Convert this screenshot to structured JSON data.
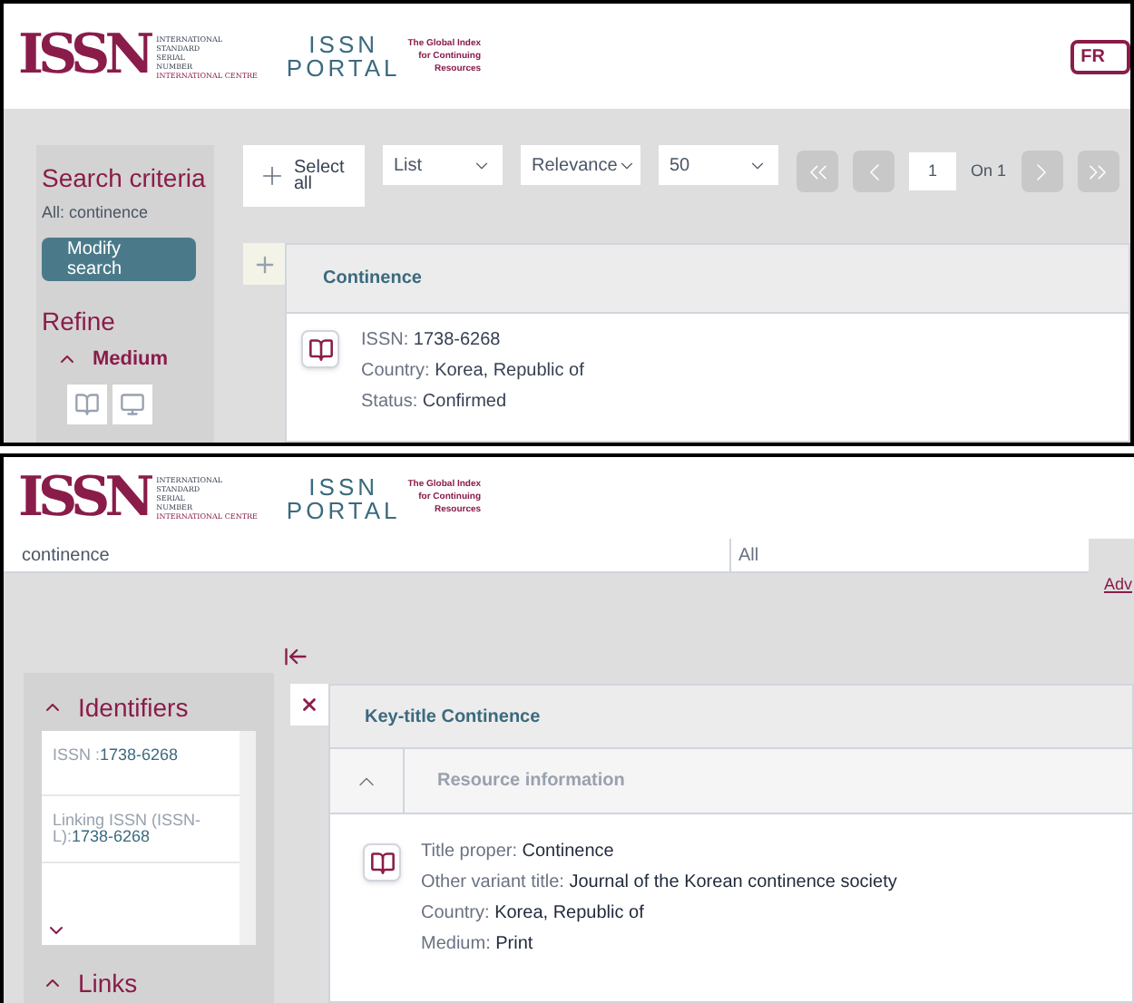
{
  "results_view": {
    "header": {
      "logo": {
        "mark": "ISSN",
        "lines": [
          "INTERNATIONAL",
          "STANDARD",
          "SERIAL",
          "NUMBER",
          "INTERNATIONAL CENTRE"
        ]
      },
      "portal_logo": {
        "top": "ISSN",
        "bottom": "PORTAL",
        "tagline": [
          "The Global Index",
          "for Continuing",
          "Resources"
        ]
      },
      "language_button": "FR"
    },
    "sidebar": {
      "title": "Search criteria",
      "criteria": "All: continence",
      "modify_button": "Modify search",
      "refine_title": "Refine",
      "facet": {
        "label": "Medium",
        "expanded": true
      }
    },
    "toolbar": {
      "select_all": "Select all",
      "selects": [
        {
          "value": "List"
        },
        {
          "value": "Relevance"
        },
        {
          "value": "50"
        }
      ],
      "pagination": {
        "first": {
          "disabled": true
        },
        "previous": {
          "disabled": true
        },
        "page": "1",
        "of": "On 1",
        "next": {
          "disabled": true
        },
        "last": {
          "disabled": true
        }
      }
    },
    "result": {
      "title": "Continence",
      "fields": [
        {
          "label": "ISSN:",
          "value": "1738-6268"
        },
        {
          "label": "Country:",
          "value": "Korea, Republic of"
        },
        {
          "label": "Status:",
          "value": "Confirmed"
        }
      ]
    }
  },
  "record_view": {
    "header": {
      "logo": {
        "mark": "ISSN",
        "lines": [
          "INTERNATIONAL",
          "STANDARD",
          "SERIAL",
          "NUMBER",
          "INTERNATIONAL CENTRE"
        ]
      },
      "portal_logo": {
        "top": "ISSN",
        "bottom": "PORTAL",
        "tagline": [
          "The Global Index",
          "for Continuing",
          "Resources"
        ]
      }
    },
    "search": {
      "query": "continence",
      "scope": "All",
      "advanced_link": "Adv"
    },
    "sidebar": {
      "sections": [
        {
          "title": "Identifiers",
          "expanded": true,
          "items": [
            {
              "label": "ISSN :",
              "value": "1738-6268"
            },
            {
              "label": "Linking ISSN (ISSN-L):",
              "value": "1738-6268"
            }
          ]
        },
        {
          "title": "Links",
          "expanded": true
        }
      ]
    },
    "record": {
      "title": "Key-title Continence",
      "section": {
        "title": "Resource information",
        "expanded": true
      },
      "fields": [
        {
          "label": "Title proper:",
          "value": "Continence"
        },
        {
          "label": "Other variant title:",
          "value": "Journal of the Korean continence society"
        },
        {
          "label": "Country:",
          "value": "Korea, Republic of"
        },
        {
          "label": "Medium:",
          "value": "Print"
        }
      ]
    }
  }
}
